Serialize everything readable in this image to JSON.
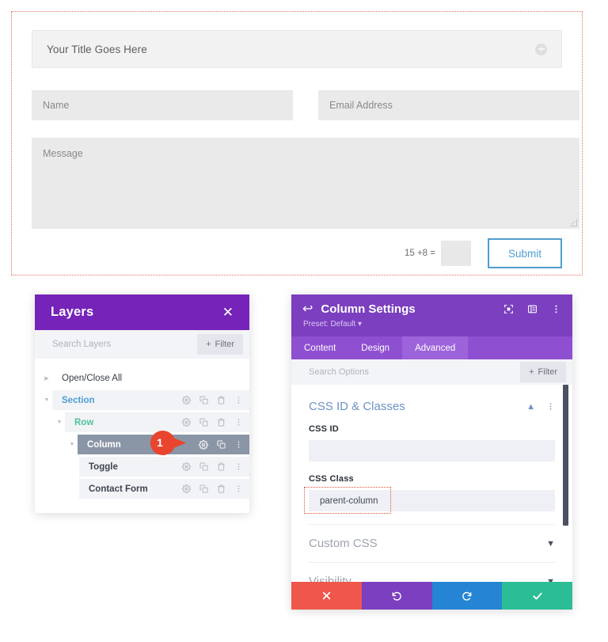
{
  "form_preview": {
    "toggle_title": "Your Title Goes Here",
    "toggle_icon": "plus-circle-icon",
    "name_placeholder": "Name",
    "email_placeholder": "Email Address",
    "message_placeholder": "Message",
    "captcha_label": "15 +8 =",
    "captcha_value": "",
    "submit_label": "Submit",
    "highlight_color": "#e06c5a"
  },
  "layers_panel": {
    "title": "Layers",
    "close_icon": "close-icon",
    "search_placeholder": "Search Layers",
    "filter_label": "Filter",
    "open_close_all": "Open/Close All",
    "header_color": "#7523b8",
    "items": [
      {
        "label": "Section",
        "level": 1,
        "color": "#4c9fd5",
        "selected": false,
        "caret": "open"
      },
      {
        "label": "Row",
        "level": 2,
        "color": "#4ec39b",
        "selected": false,
        "caret": "open"
      },
      {
        "label": "Column",
        "level": 3,
        "color": "#ffffff",
        "selected": true,
        "caret": "open"
      },
      {
        "label": "Toggle",
        "level": 4,
        "color": "#3d4450",
        "selected": false,
        "caret": "none"
      },
      {
        "label": "Contact Form",
        "level": 4,
        "color": "#3d4450",
        "selected": false,
        "caret": "none"
      }
    ],
    "row_action_icons": [
      "gear-icon",
      "duplicate-icon",
      "trash-icon",
      "kebab-menu-icon"
    ],
    "marker": {
      "number": "1",
      "color": "#e8442e"
    }
  },
  "settings_panel": {
    "back_icon": "back-arrow-icon",
    "title": "Column Settings",
    "preset": "Preset: Default",
    "header_icons": [
      "fullscreen-icon",
      "layout-panel-icon",
      "kebab-menu-icon"
    ],
    "header_color": "#7b3fbf",
    "tabs": [
      {
        "label": "Content",
        "active": false
      },
      {
        "label": "Design",
        "active": false
      },
      {
        "label": "Advanced",
        "active": true
      }
    ],
    "search_placeholder": "Search Options",
    "filter_label": "Filter",
    "groups": [
      {
        "title": "CSS ID & Classes",
        "expanded": true,
        "chevron": "chevron-up-icon",
        "kebab": "kebab-menu-icon",
        "fields": [
          {
            "label": "CSS ID",
            "value": "",
            "highlighted": false
          },
          {
            "label": "CSS Class",
            "value": "parent-column",
            "highlighted": true
          }
        ]
      },
      {
        "title": "Custom CSS",
        "expanded": false,
        "chevron": "chevron-down-icon"
      },
      {
        "title": "Visibility",
        "expanded": false,
        "chevron": "chevron-down-icon"
      }
    ],
    "footer_buttons": [
      {
        "name": "cancel",
        "icon": "close-icon",
        "color": "#f0564c"
      },
      {
        "name": "undo",
        "icon": "undo-icon",
        "color": "#7b3fbf"
      },
      {
        "name": "redo",
        "icon": "redo-icon",
        "color": "#2585d4"
      },
      {
        "name": "save",
        "icon": "check-icon",
        "color": "#2bbd96"
      }
    ],
    "highlight_color": "#e0503c"
  }
}
